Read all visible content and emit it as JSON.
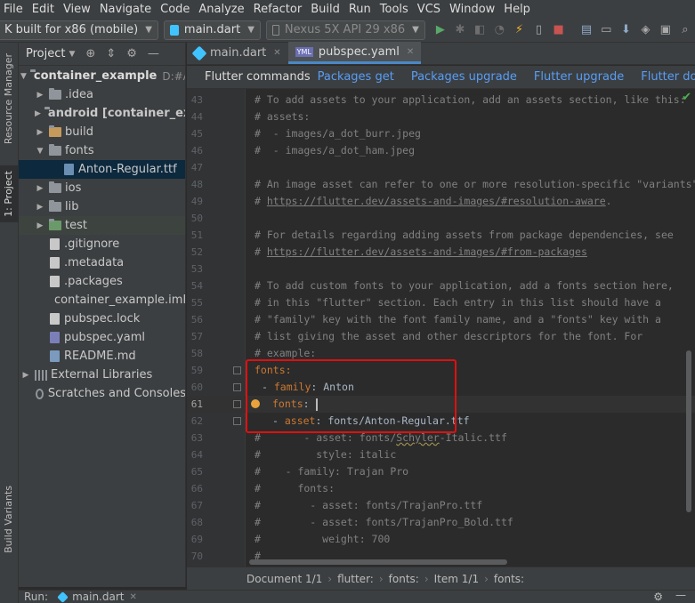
{
  "menu": [
    "File",
    "Edit",
    "View",
    "Navigate",
    "Code",
    "Analyze",
    "Refactor",
    "Build",
    "Run",
    "Tools",
    "VCS",
    "Window",
    "Help"
  ],
  "toolbar": {
    "config_combo": "K built for x86 (mobile)",
    "run_target": "main.dart",
    "device": "Nexus 5X API 29 x86"
  },
  "left_strip": {
    "resource_manager": "Resource Manager",
    "project": "1: Project",
    "build_variants": "Build Variants"
  },
  "project_panel": {
    "title": "Project",
    "root": "container_example",
    "root_path": "D:#An",
    "items": {
      "idea": ".idea",
      "android": "android [container_exa",
      "build": "build",
      "fonts": "fonts",
      "anton": "Anton-Regular.ttf",
      "ios": "ios",
      "lib": "lib",
      "test": "test",
      "gitignore": ".gitignore",
      "metadata": ".metadata",
      "packages": ".packages",
      "iml": "container_example.iml",
      "lock": "pubspec.lock",
      "yaml": "pubspec.yaml",
      "readme": "README.md",
      "external": "External Libraries",
      "scratches": "Scratches and Consoles"
    }
  },
  "tabs": [
    "main.dart",
    "pubspec.yaml"
  ],
  "flutter_bar": {
    "label": "Flutter commands",
    "links": [
      "Packages get",
      "Packages upgrade",
      "Flutter upgrade",
      "Flutter doctor"
    ]
  },
  "code": {
    "l43": "# To add assets to your application, add an assets section, like this:",
    "l44": "# assets:",
    "l45": "#  - images/a_dot_burr.jpeg",
    "l46": "#  - images/a_dot_ham.jpeg",
    "l47": "",
    "l48": "# An image asset can refer to one or more resolution-specific \"variants\", see",
    "l49_pre": "# ",
    "l49_url": "https://flutter.dev/assets-and-images/#resolution-aware",
    "l49_post": ".",
    "l50": "",
    "l51": "# For details regarding adding assets from package dependencies, see",
    "l52_pre": "# ",
    "l52_url": "https://flutter.dev/assets-and-images/#from-packages",
    "l53": "",
    "l54": "# To add custom fonts to your application, add a fonts section here,",
    "l55": "# in this \"flutter\" section. Each entry in this list should have a",
    "l56": "# \"family\" key with the font family name, and a \"fonts\" key with a",
    "l57": "# list giving the asset and other descriptors for the font. For",
    "l58": "# example:",
    "l59": "fonts:",
    "l60_dash": "- ",
    "l60_key": "family",
    "l60_val": ": Anton",
    "l61_key": "fonts",
    "l61_colon": ":",
    "l62_dash": "- ",
    "l62_key": "asset",
    "l62_val": ": fonts/Anton-Regular.ttf",
    "l63_a": "#       - asset: fonts/",
    "l63_b": "Schyler",
    "l63_c": "-Italic.ttf",
    "l64": "#         style: italic",
    "l65": "#    - family: Trajan Pro",
    "l66": "#      fonts:",
    "l67": "#        - asset: fonts/TrajanPro.ttf",
    "l68": "#        - asset: fonts/TrajanPro_Bold.ttf",
    "l69": "#          weight: 700",
    "l70": "#"
  },
  "line_numbers": [
    "43",
    "44",
    "45",
    "46",
    "47",
    "48",
    "49",
    "50",
    "51",
    "52",
    "53",
    "54",
    "55",
    "56",
    "57",
    "58",
    "59",
    "60",
    "61",
    "62",
    "63",
    "64",
    "65",
    "66",
    "67",
    "68",
    "69",
    "70"
  ],
  "breadcrumb": [
    "Document 1/1",
    "flutter:",
    "fonts:",
    "Item 1/1",
    "fonts:"
  ],
  "runbar": {
    "run_label": "Run:",
    "run_tab": "main.dart",
    "left_label": "ures"
  },
  "colors": {
    "annotation": "#e01010",
    "link": "#589df6"
  }
}
